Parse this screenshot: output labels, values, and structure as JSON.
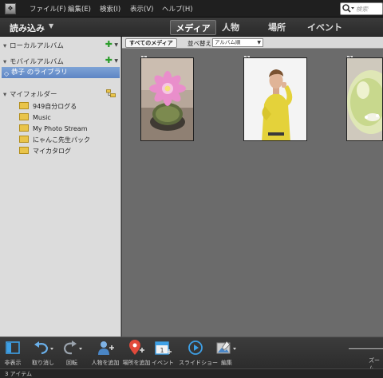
{
  "menubar": {
    "items": [
      "ファイル(F)",
      "編集(E)",
      "検索(I)",
      "表示(V)",
      "ヘルプ(H)"
    ],
    "search_placeholder": "検索"
  },
  "header": {
    "import_label": "読み込み",
    "tabs": [
      "メディア",
      "人物",
      "場所",
      "イベント"
    ],
    "active_tab": "メディア"
  },
  "sidebar": {
    "local_albums": "ローカルアルバム",
    "mobile_albums": "モバイルアルバム",
    "library_item": "恭子 のライブラリ",
    "my_folders": "マイフォルダー",
    "folders": [
      "949自分ログる",
      "Music",
      "My Photo Stream",
      "にゃんこ先生パック",
      "マイカタログ"
    ]
  },
  "content": {
    "all_media": "すべてのメディア",
    "sort_label": "並べ替え",
    "sort_value": "アルバム順",
    "thumbnails": [
      {
        "num": "1",
        "subject": "pink cactus flower"
      },
      {
        "num": "2",
        "subject": "man in yellow sweater"
      },
      {
        "num": "3",
        "subject": "pale green round object"
      }
    ]
  },
  "toolbar": {
    "hide": "非表示",
    "undo": "取り消し",
    "rotate": "回転",
    "add_people": "人物を追加",
    "add_place": "場所を追加",
    "event": "イベント",
    "slideshow": "スライドショー",
    "edit": "編集",
    "zoom": "ズーム"
  },
  "status": {
    "items": "3 アイテム"
  },
  "colors": {
    "accent": "#5d85c4",
    "plus": "#2a9d2a",
    "folder": "#e9c44a"
  }
}
